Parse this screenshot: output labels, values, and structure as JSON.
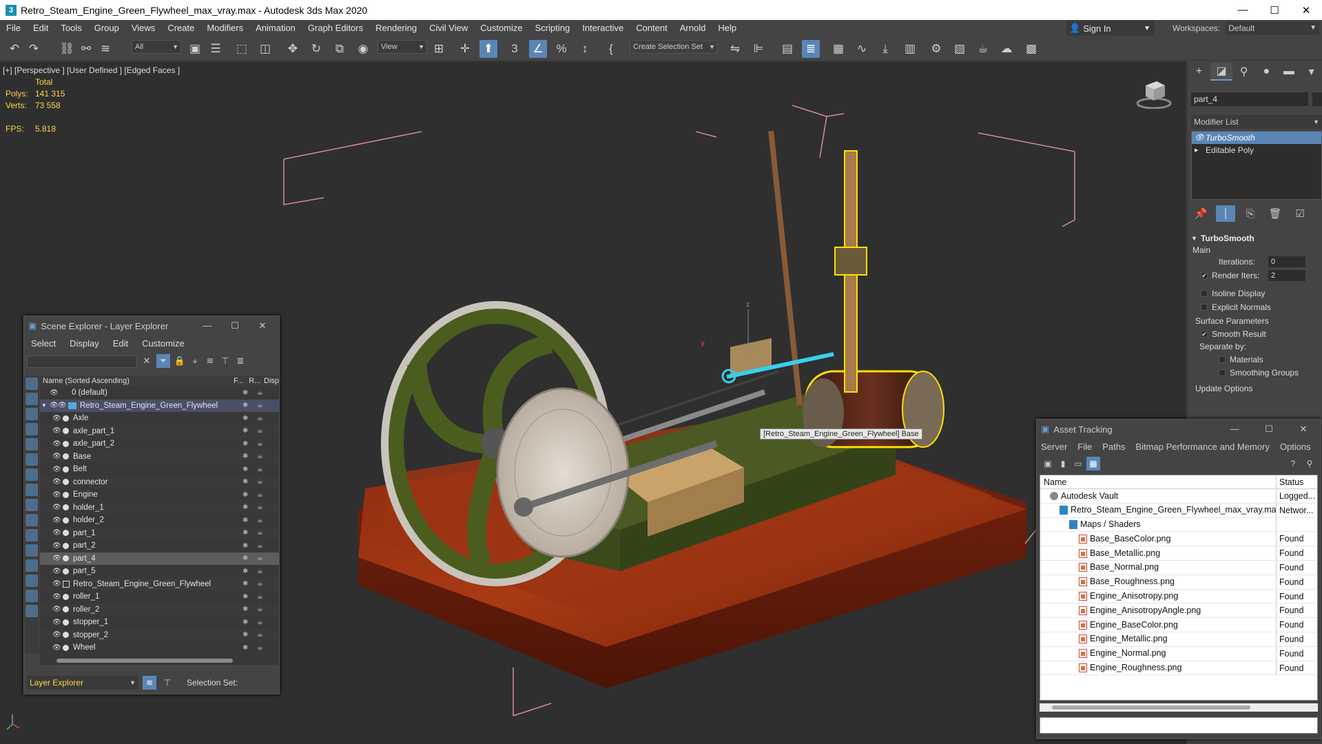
{
  "window": {
    "title": "Retro_Steam_Engine_Green_Flywheel_max_vray.max - Autodesk 3ds Max 2020",
    "app_icon": "3"
  },
  "menubar": {
    "items": [
      "File",
      "Edit",
      "Tools",
      "Group",
      "Views",
      "Create",
      "Modifiers",
      "Animation",
      "Graph Editors",
      "Rendering",
      "Civil View",
      "Customize",
      "Scripting",
      "Interactive",
      "Content",
      "Arnold",
      "Help"
    ],
    "sign_in": "Sign In",
    "workspaces_label": "Workspaces:",
    "workspaces_value": "Default"
  },
  "toolbar": {
    "filter_value": "All",
    "refcoord_value": "View",
    "selection_set_placeholder": "Create Selection Set",
    "snap_label": "3"
  },
  "viewport": {
    "label": "[+] [Perspective ] [User Defined ] [Edged Faces ]",
    "stats_header": "Total",
    "polys_label": "Polys:",
    "polys_value": "141 315",
    "verts_label": "Verts:",
    "verts_value": "73 558",
    "fps_label": "FPS:",
    "fps_value": "5.818",
    "tooltip": "[Retro_Steam_Engine_Green_Flywheel] Base",
    "gizmo_z": "z",
    "gizmo_y": "y"
  },
  "command_panel": {
    "object_name": "part_4",
    "modifier_list": "Modifier List",
    "stack": [
      {
        "label": "TurboSmooth",
        "selected": true
      },
      {
        "label": "Editable Poly",
        "selected": false
      }
    ],
    "rollout_title": "TurboSmooth",
    "main_label": "Main",
    "iterations_label": "Iterations:",
    "iterations_value": "0",
    "render_iters_label": "Render Iters:",
    "render_iters_value": "2",
    "isoline_label": "Isoline Display",
    "explicit_normals_label": "Explicit Normals",
    "surface_params_label": "Surface Parameters",
    "smooth_result_label": "Smooth Result",
    "separate_by_label": "Separate by:",
    "materials_label": "Materials",
    "smoothing_groups_label": "Smoothing Groups",
    "update_options_label": "Update Options"
  },
  "scene_explorer": {
    "title": "Scene Explorer - Layer Explorer",
    "menu": [
      "Select",
      "Display",
      "Edit",
      "Customize"
    ],
    "col_name": "Name (Sorted Ascending)",
    "col_f": "F...",
    "col_r": "R...",
    "col_disp": "Disp",
    "rows": [
      {
        "label": "0 (default)",
        "indent": 0,
        "kind": "layer"
      },
      {
        "label": "Retro_Steam_Engine_Green_Flywheel",
        "indent": 0,
        "kind": "layer-active"
      },
      {
        "label": "Axle",
        "indent": 1,
        "kind": "object"
      },
      {
        "label": "axle_part_1",
        "indent": 1,
        "kind": "object"
      },
      {
        "label": "axle_part_2",
        "indent": 1,
        "kind": "object"
      },
      {
        "label": "Base",
        "indent": 1,
        "kind": "object"
      },
      {
        "label": "Belt",
        "indent": 1,
        "kind": "object"
      },
      {
        "label": "connector",
        "indent": 1,
        "kind": "object"
      },
      {
        "label": "Engine",
        "indent": 1,
        "kind": "object"
      },
      {
        "label": "holder_1",
        "indent": 1,
        "kind": "object"
      },
      {
        "label": "holder_2",
        "indent": 1,
        "kind": "object"
      },
      {
        "label": "part_1",
        "indent": 1,
        "kind": "object"
      },
      {
        "label": "part_2",
        "indent": 1,
        "kind": "object"
      },
      {
        "label": "part_4",
        "indent": 1,
        "kind": "selected"
      },
      {
        "label": "part_5",
        "indent": 1,
        "kind": "object"
      },
      {
        "label": "Retro_Steam_Engine_Green_Flywheel",
        "indent": 1,
        "kind": "group"
      },
      {
        "label": "roller_1",
        "indent": 1,
        "kind": "object"
      },
      {
        "label": "roller_2",
        "indent": 1,
        "kind": "object"
      },
      {
        "label": "stopper_1",
        "indent": 1,
        "kind": "object"
      },
      {
        "label": "stopper_2",
        "indent": 1,
        "kind": "object"
      },
      {
        "label": "Wheel",
        "indent": 1,
        "kind": "object"
      }
    ],
    "footer_layer": "Layer Explorer",
    "selection_set_label": "Selection Set:"
  },
  "asset_tracking": {
    "title": "Asset Tracking",
    "menu": [
      "Server",
      "File",
      "Paths",
      "Bitmap Performance and Memory",
      "Options"
    ],
    "col_name": "Name",
    "col_status": "Status",
    "rows": [
      {
        "name": "Autodesk Vault",
        "status": "Logged...",
        "indent": 1,
        "icon": "vault"
      },
      {
        "name": "Retro_Steam_Engine_Green_Flywheel_max_vray.max",
        "status": "Networ...",
        "indent": 2,
        "icon": "max"
      },
      {
        "name": "Maps / Shaders",
        "status": "",
        "indent": 3,
        "icon": "folder"
      },
      {
        "name": "Base_BaseColor.png",
        "status": "Found",
        "indent": 4,
        "icon": "file"
      },
      {
        "name": "Base_Metallic.png",
        "status": "Found",
        "indent": 4,
        "icon": "file"
      },
      {
        "name": "Base_Normal.png",
        "status": "Found",
        "indent": 4,
        "icon": "file"
      },
      {
        "name": "Base_Roughness.png",
        "status": "Found",
        "indent": 4,
        "icon": "file"
      },
      {
        "name": "Engine_Anisotropy.png",
        "status": "Found",
        "indent": 4,
        "icon": "file"
      },
      {
        "name": "Engine_AnisotropyAngle.png",
        "status": "Found",
        "indent": 4,
        "icon": "file"
      },
      {
        "name": "Engine_BaseColor.png",
        "status": "Found",
        "indent": 4,
        "icon": "file"
      },
      {
        "name": "Engine_Metallic.png",
        "status": "Found",
        "indent": 4,
        "icon": "file"
      },
      {
        "name": "Engine_Normal.png",
        "status": "Found",
        "indent": 4,
        "icon": "file"
      },
      {
        "name": "Engine_Roughness.png",
        "status": "Found",
        "indent": 4,
        "icon": "file"
      }
    ]
  },
  "colors": {
    "accent": "#5a86b6",
    "stats_yellow": "#ffd54a",
    "selection_outline": "#ffe000"
  }
}
